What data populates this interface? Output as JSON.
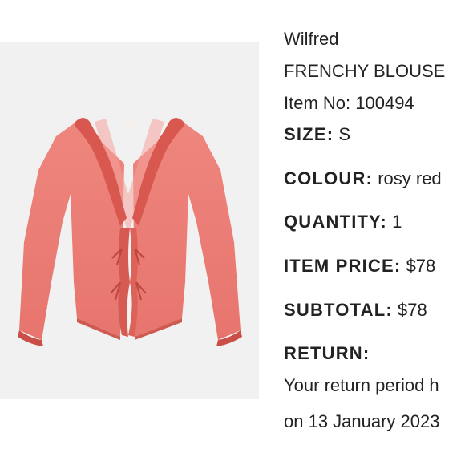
{
  "product": {
    "brand": "Wilfred",
    "name": "FRENCHY BLOUSE",
    "item_no": "Item No: 100494",
    "image_icon": "coral-ruffle-tie-front-blouse-image",
    "garment_color": "#e8706a"
  },
  "order_details": {
    "size_label": "SIZE:",
    "size_value": "S",
    "colour_label": "COLOUR:",
    "colour_value": "rosy red",
    "quantity_label": "QUANTITY:",
    "quantity_value": "1",
    "item_price_label": "ITEM PRICE:",
    "item_price_value": "$78",
    "subtotal_label": "SUBTOTAL:",
    "subtotal_value": "$78",
    "return_label": "RETURN:",
    "return_text_line1": "Your return period h",
    "return_text_line2": "on 13 January 2023"
  }
}
